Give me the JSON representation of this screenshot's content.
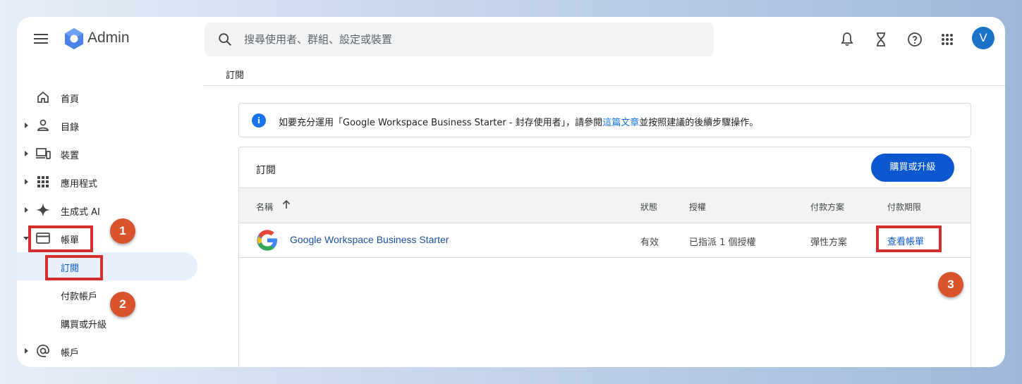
{
  "header": {
    "app_name": "Admin",
    "search_placeholder": "搜尋使用者、群組、設定或裝置",
    "avatar_letter": "V"
  },
  "breadcrumb": "訂閱",
  "sidebar": {
    "items": [
      {
        "label": "首頁",
        "icon": "home-icon"
      },
      {
        "label": "目錄",
        "icon": "person-icon"
      },
      {
        "label": "裝置",
        "icon": "devices-icon"
      },
      {
        "label": "應用程式",
        "icon": "apps-grid-icon"
      },
      {
        "label": "生成式 AI",
        "icon": "sparkle-icon"
      },
      {
        "label": "帳單",
        "icon": "credit-card-icon"
      },
      {
        "label": "訂閱"
      },
      {
        "label": "付款帳戶"
      },
      {
        "label": "購買或升級"
      },
      {
        "label": "帳戶",
        "icon": "at-sign-icon"
      }
    ]
  },
  "callouts": [
    "1",
    "2",
    "3"
  ],
  "info": {
    "text_before": "如要充分運用「Google Workspace Business Starter - 封存使用者」，請參閱",
    "link": "這篇文章",
    "text_after": "並按照建議的後續步驟操作。"
  },
  "card": {
    "title": "訂閱",
    "buy_button": "購買或升級",
    "columns": [
      "名稱",
      "狀態",
      "授權",
      "付款方案",
      "付款期限"
    ],
    "rows": [
      {
        "name": "Google Workspace Business Starter",
        "status": "有效",
        "licenses": "已指派 1 個授權",
        "plan": "彈性方案",
        "action": "查看帳單"
      }
    ]
  },
  "colors": {
    "accent": "#0b57d0",
    "callout": "#d9532c",
    "highlight_box": "#d32f2f"
  }
}
